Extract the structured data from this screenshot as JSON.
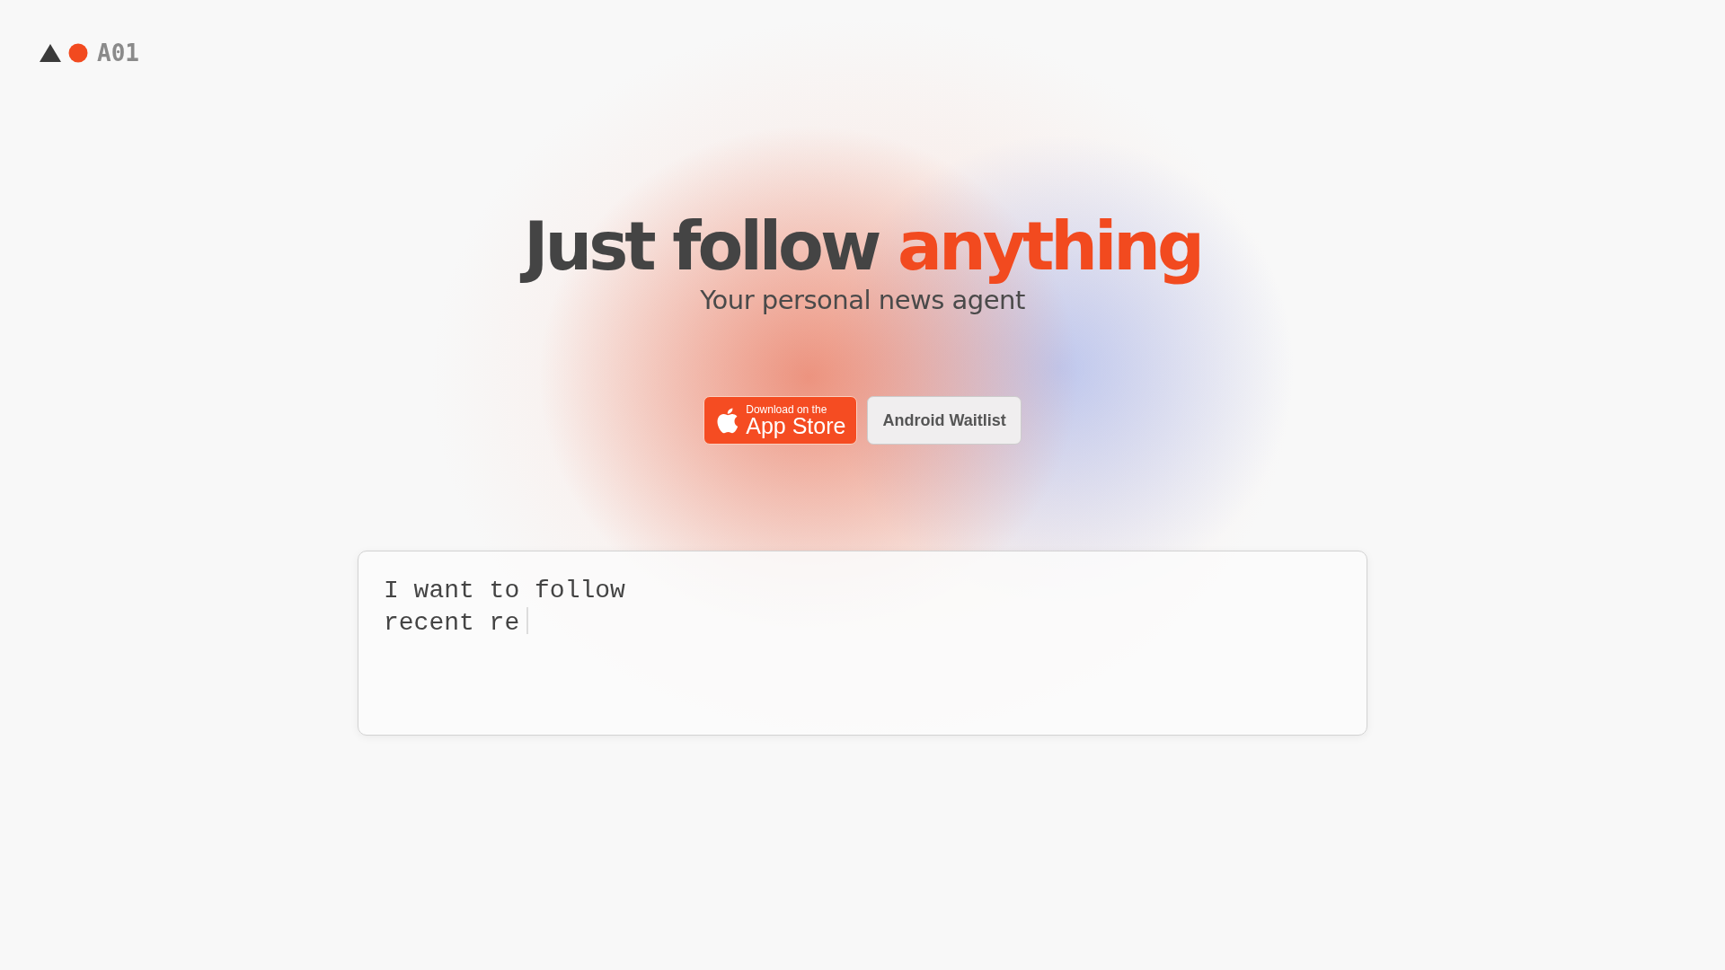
{
  "logo": {
    "text": "A01"
  },
  "hero": {
    "title": "Just follow",
    "title_highlight": "anything",
    "subtitle": "Your personal news agent"
  },
  "buttons": [
    {
      "kind": "appstore",
      "small": "Download on the",
      "label": "App Store"
    },
    {
      "kind": "plain",
      "label": "Android Waitlist"
    }
  ],
  "prompt": {
    "value": "I want to follow\nrecent re"
  }
}
